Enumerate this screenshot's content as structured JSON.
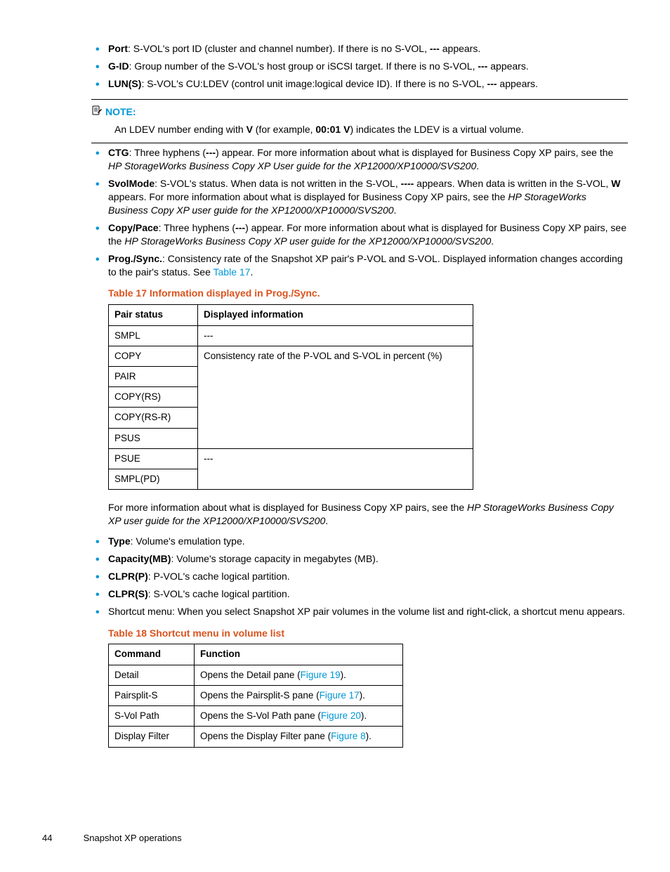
{
  "bullets1": {
    "port": {
      "term": "Port",
      "text": ": S-VOL's port ID (cluster and channel number). If there is no S-VOL, ",
      "dash": "---",
      "tail": " appears."
    },
    "gid": {
      "term": "G-ID",
      "text": ": Group number of the S-VOL's host group or iSCSI target. If there is no S-VOL, ",
      "dash": "---",
      "tail": " appears."
    },
    "lun": {
      "term": "LUN(S)",
      "text": ": S-VOL's CU:LDEV (control unit image:logical device ID). If there is no S-VOL, ",
      "dash": "---",
      "tail": " appears."
    }
  },
  "note": {
    "label": "NOTE:",
    "pre": "An LDEV number ending with ",
    "v": "V",
    "mid": " (for example, ",
    "ex": "00:01 V",
    "post": ") indicates the LDEV is a virtual volume."
  },
  "bullets2": {
    "ctg": {
      "term": "CTG",
      "a": ": Three hyphens (",
      "dash": "---",
      "b": ") appear. For more information about what is displayed for Business Copy XP pairs, see the ",
      "ital": "HP StorageWorks Business Copy XP User guide for the XP12000/XP10000/SVS200",
      "c": "."
    },
    "svol": {
      "term": "SvolMode",
      "a": ": S-VOL's status. When data is not written in the S-VOL, ",
      "dash1": "----",
      "b": " appears. When data is written in the S-VOL, ",
      "w": "W",
      "c": " appears. For more information about what is displayed for Business Copy XP pairs, see the ",
      "ital": "HP StorageWorks Business Copy XP user guide for the XP12000/XP10000/SVS200",
      "d": "."
    },
    "copy": {
      "term": "Copy/Pace",
      "a": ": Three hyphens (",
      "dash": "---",
      "b": ") appear. For more information about what is displayed for Business Copy XP pairs, see the ",
      "ital": "HP StorageWorks Business Copy XP user guide for the XP12000/XP10000/SVS200",
      "c": "."
    },
    "prog": {
      "term": "Prog./Sync.",
      "a": ": Consistency rate of the Snapshot XP pair's P-VOL and S-VOL. Displayed information changes according to the pair's status. See ",
      "link": "Table 17",
      "b": "."
    }
  },
  "table17": {
    "caption": "Table 17 Information displayed in Prog./Sync.",
    "h1": "Pair status",
    "h2": "Displayed information",
    "r1c1": "SMPL",
    "r1c2": "---",
    "r2c1": "COPY",
    "r2c2": "Consistency rate of the P-VOL and S-VOL in percent (%)",
    "r3c1": "PAIR",
    "r4c1": "COPY(RS)",
    "r5c1": "COPY(RS-R)",
    "r6c1": "PSUS",
    "r7c1": "PSUE",
    "r7c2": "---",
    "r8c1": "SMPL(PD)"
  },
  "afterTable17": {
    "a": "For more information about what is displayed for Business Copy XP pairs, see the ",
    "ital": "HP StorageWorks Business Copy XP user guide for the XP12000/XP10000/SVS200",
    "b": "."
  },
  "bullets3": {
    "type": {
      "term": "Type",
      "text": ": Volume's emulation type."
    },
    "cap": {
      "term": "Capacity(MB)",
      "text": ": Volume's storage capacity in megabytes (MB)."
    },
    "clprp": {
      "term": "CLPR(P)",
      "text": ": P-VOL's cache logical partition."
    },
    "clprs": {
      "term": "CLPR(S)",
      "text": ": S-VOL's cache logical partition."
    },
    "shortcut": {
      "text": "Shortcut menu: When you select Snapshot XP pair volumes in the volume list and right-click, a shortcut menu appears."
    }
  },
  "table18": {
    "caption": "Table 18 Shortcut menu in volume list",
    "h1": "Command",
    "h2": "Function",
    "r1c1": "Detail",
    "r1a": "Opens the Detail pane (",
    "r1link": "Figure 19",
    "r1b": ").",
    "r2c1": "Pairsplit-S",
    "r2a": "Opens the Pairsplit-S pane (",
    "r2link": "Figure 17",
    "r2b": ").",
    "r3c1": "S-Vol Path",
    "r3a": "Opens the S-Vol Path pane (",
    "r3link": "Figure 20",
    "r3b": ").",
    "r4c1": "Display Filter",
    "r4a": "Opens the Display Filter pane (",
    "r4link": "Figure 8",
    "r4b": ")."
  },
  "footer": {
    "page": "44",
    "text": "Snapshot XP operations"
  }
}
